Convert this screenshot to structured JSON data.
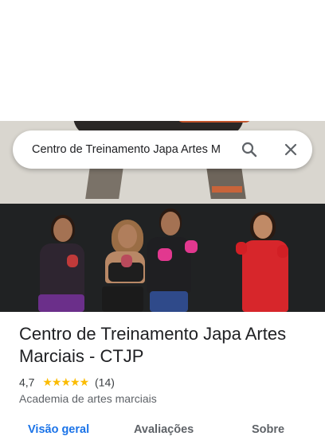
{
  "search": {
    "query": "Centro de Treinamento Japa Artes M",
    "search_icon": "search-icon",
    "close_icon": "close-icon"
  },
  "place": {
    "title": "Centro de Treinamento Japa Artes Marciais - CTJP",
    "rating": "4,7",
    "stars": "★★★★★",
    "rating_value": 4.7,
    "review_count": "(14)",
    "category": "Academia de artes marciais"
  },
  "tabs": [
    {
      "label": "Visão geral",
      "active": true
    },
    {
      "label": "Avaliações",
      "active": false
    },
    {
      "label": "Sobre",
      "active": false
    }
  ],
  "colors": {
    "accent": "#1a73e8",
    "star": "#fbbc04"
  }
}
